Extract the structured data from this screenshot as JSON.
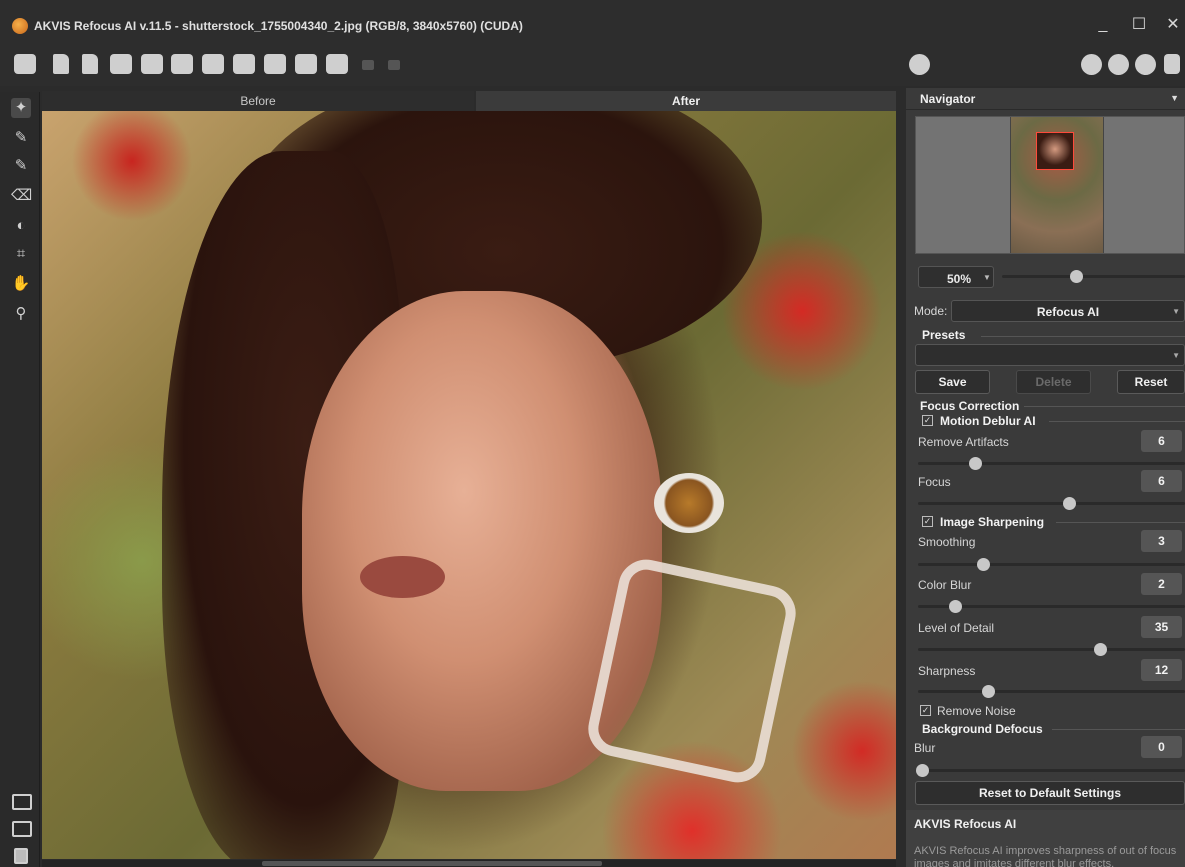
{
  "window": {
    "title": "AKVIS Refocus AI v.11.5 - shutterstock_1755004340_2.jpg (RGB/8, 3840x5760) (CUDA)",
    "minimize": "_",
    "maximize": "☐",
    "close": "✕"
  },
  "tabs": {
    "before": "Before",
    "after": "After"
  },
  "navigator": {
    "title": "Navigator",
    "zoom": "50%"
  },
  "settings": {
    "mode_label": "Mode:",
    "mode_value": "Refocus AI",
    "presets_label": "Presets",
    "save": "Save",
    "delete": "Delete",
    "reset": "Reset",
    "focus_correction": "Focus Correction",
    "motion_deblur": "Motion Deblur AI",
    "remove_artifacts": {
      "label": "Remove Artifacts",
      "value": "6",
      "level": 0.21
    },
    "focus": {
      "label": "Focus",
      "value": "6",
      "level": 0.58
    },
    "image_sharpening": "Image Sharpening",
    "smoothing": {
      "label": "Smoothing",
      "value": "3",
      "level": 0.24
    },
    "color_blur": {
      "label": "Color Blur",
      "value": "2",
      "level": 0.13
    },
    "level_of_detail": {
      "label": "Level of Detail",
      "value": "35",
      "level": 0.7
    },
    "sharpness": {
      "label": "Sharpness",
      "value": "12",
      "level": 0.26
    },
    "remove_noise": "Remove Noise",
    "background_defocus": "Background Defocus",
    "blur": {
      "label": "Blur",
      "value": "0",
      "level": 0.0
    },
    "reset_default": "Reset to Default Settings"
  },
  "about": {
    "title": "AKVIS Refocus AI",
    "text": "AKVIS Refocus AI improves sharpness of out of focus images and imitates different blur effects."
  },
  "colors": {
    "panel": "#3a3a3a",
    "accent_navigator_rect": "#ff4a3a"
  }
}
